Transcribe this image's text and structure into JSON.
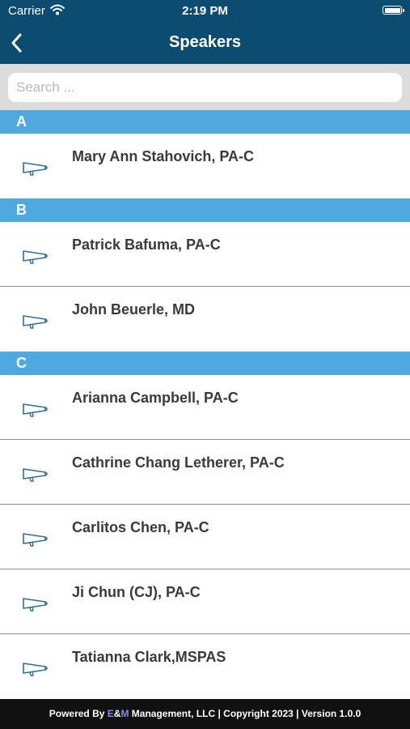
{
  "status_bar": {
    "carrier": "Carrier",
    "time": "2:19 PM"
  },
  "header": {
    "title": "Speakers"
  },
  "search": {
    "placeholder": "Search ..."
  },
  "sections": [
    {
      "letter": "A",
      "speakers": [
        "Mary Ann Stahovich, PA-C"
      ]
    },
    {
      "letter": "B",
      "speakers": [
        "Patrick Bafuma, PA-C",
        "John Beuerle, MD"
      ]
    },
    {
      "letter": "C",
      "speakers": [
        "Arianna Campbell, PA-C",
        "Cathrine Chang Letherer, PA-C",
        "Carlitos Chen, PA-C",
        "Ji Chun (CJ), PA-C",
        "Tatianna Clark,MSPAS"
      ]
    }
  ],
  "footer": {
    "prefix": "Powered By ",
    "brand_e": "E",
    "brand_amp": "&",
    "brand_m": "M",
    "suffix": " Management, LLC | Copyright 2023 | Version 1.0.0"
  },
  "colors": {
    "header": "#0b4c70",
    "section": "#4fa9e1",
    "search_bg": "#dcdcdc",
    "footer": "#111111",
    "icon": "#2f6f9a"
  },
  "icons": {
    "row_icon": "megaphone-icon",
    "back": "chevron-left-icon"
  }
}
